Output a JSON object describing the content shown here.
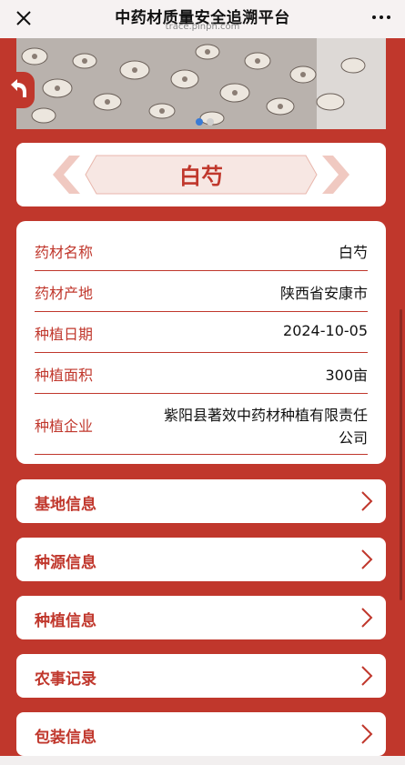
{
  "topbar": {
    "title": "中药材质量安全追溯平台",
    "url": "trace.pinph.com"
  },
  "colors": {
    "brand": "#c0372c",
    "panel": "#ffffff",
    "accent_dot": "#3a7bd5"
  },
  "icons": [
    "close-icon",
    "more-icon",
    "back-arrow-icon",
    "chevron-right-icon"
  ],
  "herb": {
    "name": "白芍"
  },
  "info": {
    "rows": [
      {
        "label": "药材名称",
        "value": "白芍"
      },
      {
        "label": "药材产地",
        "value": "陕西省安康市"
      },
      {
        "label": "种植日期",
        "value": "2024-10-05"
      },
      {
        "label": "种植面积",
        "value": "300亩"
      },
      {
        "label": "种植企业",
        "value_line1": "紫阳县著效中药材种植有限责任",
        "value_line2": "公司"
      }
    ]
  },
  "sections": [
    {
      "label": "基地信息"
    },
    {
      "label": "种源信息"
    },
    {
      "label": "种植信息"
    },
    {
      "label": "农事记录"
    },
    {
      "label": "包装信息"
    }
  ]
}
